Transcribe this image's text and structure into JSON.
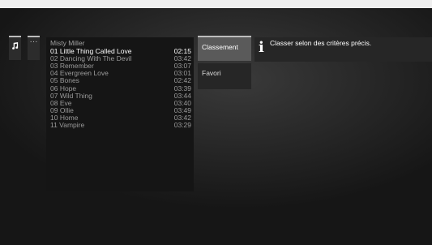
{
  "album": {
    "title": "Misty Miller"
  },
  "tracks": [
    {
      "name": "01 Little Thing Called Love",
      "duration": "02:15"
    },
    {
      "name": "02 Dancing With The Devil",
      "duration": "03:42"
    },
    {
      "name": "03 Remember",
      "duration": "03:07"
    },
    {
      "name": "04 Evergreen Love",
      "duration": "03:01"
    },
    {
      "name": "05 Bones",
      "duration": "02:42"
    },
    {
      "name": "06 Hope",
      "duration": "03:39"
    },
    {
      "name": "07 Wild Thing",
      "duration": "03:44"
    },
    {
      "name": "08 Eve",
      "duration": "03:40"
    },
    {
      "name": "09 Ollie",
      "duration": "03:49"
    },
    {
      "name": "10 Home",
      "duration": "03:42"
    },
    {
      "name": "11 Vampire",
      "duration": "03:29"
    }
  ],
  "side_icons": {
    "music": "music-note-icon",
    "more": "ellipsis-icon",
    "more_label": "···"
  },
  "menu": {
    "items": [
      {
        "label": "Classement",
        "active": true
      },
      {
        "label": "Favori",
        "active": false
      }
    ]
  },
  "info": {
    "icon": "info-icon",
    "glyph": "i",
    "text": "Classer selon des critères précis."
  },
  "colors": {
    "background": "#1a1a1a",
    "panel": "#262626",
    "highlight": "#5a5a5a",
    "accent_bar": "#bdbdbd"
  }
}
